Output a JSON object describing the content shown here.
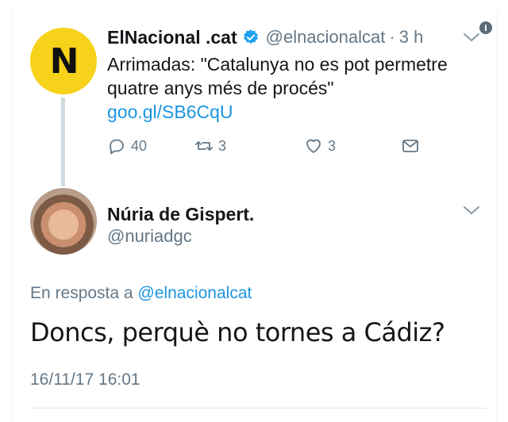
{
  "parent_tweet": {
    "avatar_letter": "N",
    "display_name": "ElNacional .cat",
    "handle": "@elnacionalcat",
    "separator": "·",
    "time": "3 h",
    "text": "Arrimadas: \"Catalunya no es pot permetre quatre anys més de procés\"",
    "link": "goo.gl/SB6CqU",
    "replies": "40",
    "retweets": "3",
    "likes": "3",
    "info_glyph": "i"
  },
  "reply_tweet": {
    "display_name": "Núria de Gispert.",
    "handle": "@nuriadgc",
    "reply_prefix": "En resposta a",
    "reply_target": "@elnacionalcat",
    "text": "Doncs, perquè no tornes a Cádiz?",
    "date": "16/11/17 16:01"
  },
  "colors": {
    "link": "#1b95e0",
    "muted": "#657786",
    "avatar_yellow": "#f7d21a",
    "thread_line": "#cfd9de"
  },
  "icons": [
    "verified-icon",
    "chevron-down-icon",
    "info-icon",
    "reply-icon",
    "retweet-icon",
    "like-icon",
    "message-icon"
  ]
}
